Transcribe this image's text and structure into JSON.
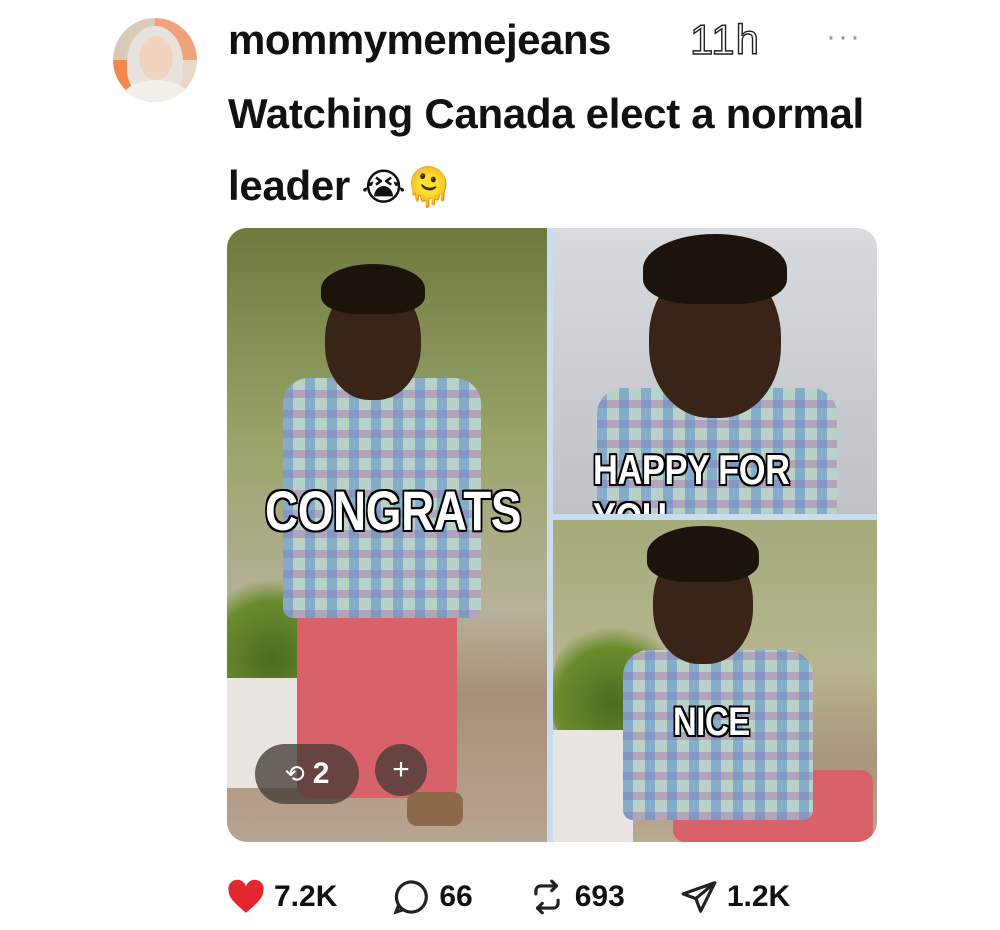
{
  "post": {
    "username": "mommymemejeans",
    "timestamp": "11h",
    "more_label": "···",
    "caption_text": "Watching Canada elect a normal leader",
    "caption_emojis": "😭🫠"
  },
  "media": {
    "panels": [
      {
        "caption": "CONGRATS"
      },
      {
        "caption": "HAPPY FOR YOU"
      },
      {
        "caption": "NICE"
      }
    ],
    "repost_count": "2",
    "plus_label": "+"
  },
  "actions": {
    "likes": "7.2K",
    "replies": "66",
    "reposts": "693",
    "shares": "1.2K"
  },
  "colors": {
    "like": "#e5252f",
    "text": "#111111",
    "grid_border": "#c9ddef"
  },
  "icons": [
    "heart-icon",
    "reply-icon",
    "repost-icon",
    "share-icon",
    "more-icon",
    "plus-icon"
  ]
}
